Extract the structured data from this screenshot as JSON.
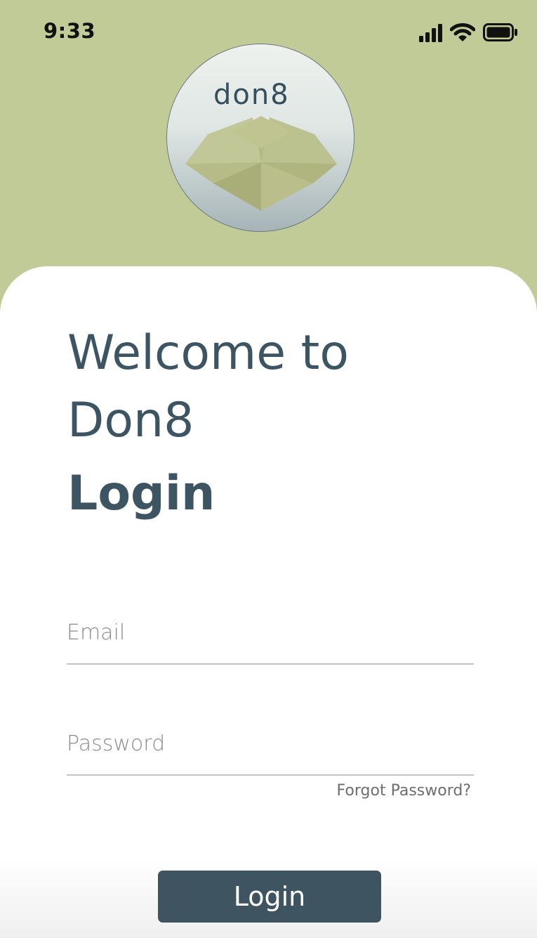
{
  "status_bar": {
    "time": "9:33",
    "icons": [
      "cellular-signal-icon",
      "wifi-icon",
      "battery-icon"
    ]
  },
  "logo": {
    "wordmark": "don8",
    "graphic": "open-cardboard-box"
  },
  "heading": {
    "welcome": "Welcome to Don8",
    "title": "Login"
  },
  "form": {
    "email": {
      "value": "",
      "placeholder": "Email"
    },
    "password": {
      "value": "",
      "placeholder": "Password"
    },
    "forgot_password": "Forgot Password?",
    "submit_label": "Login"
  },
  "colors": {
    "header_background": "#c0cb97",
    "primary": "#3d5563",
    "button": "#3e5460",
    "card": "#ffffff"
  }
}
